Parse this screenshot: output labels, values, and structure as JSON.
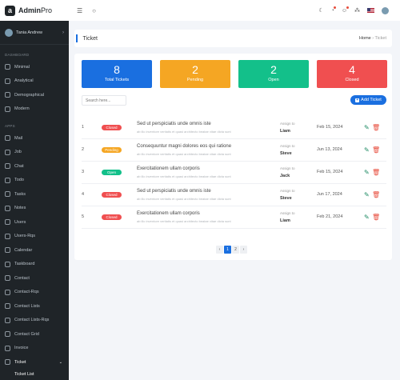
{
  "brand": {
    "name_bold": "Admin",
    "name_light": "Pro"
  },
  "user": {
    "name": "Tania Andrew"
  },
  "sidebar": {
    "dashboard_label": "DASHBOARD",
    "dashboard_items": [
      {
        "label": "Minimal"
      },
      {
        "label": "Analytical"
      },
      {
        "label": "Demographical"
      },
      {
        "label": "Modern"
      }
    ],
    "apps_label": "APPS",
    "apps_items": [
      {
        "label": "Mail"
      },
      {
        "label": "Job"
      },
      {
        "label": "Chat"
      },
      {
        "label": "Todo"
      },
      {
        "label": "Tasks"
      },
      {
        "label": "Notes"
      },
      {
        "label": "Users"
      },
      {
        "label": "Users-Rqs"
      },
      {
        "label": "Calendar"
      },
      {
        "label": "Taskboard"
      },
      {
        "label": "Contact"
      },
      {
        "label": "Contact-Rqs"
      },
      {
        "label": "Contact Lists"
      },
      {
        "label": "Contact Lists-Rqs"
      },
      {
        "label": "Contact Grid"
      },
      {
        "label": "Invoice"
      },
      {
        "label": "Ticket"
      }
    ],
    "ticket_sub": "Ticket List"
  },
  "header": {
    "title": "Ticket",
    "crumb_home": "Home",
    "crumb_sep": "›",
    "crumb_current": "Ticket"
  },
  "stats": [
    {
      "value": "8",
      "label": "Total Tickets",
      "color": "#1a6fe0"
    },
    {
      "value": "2",
      "label": "Pending",
      "color": "#f5a623"
    },
    {
      "value": "2",
      "label": "Open",
      "color": "#13c08a"
    },
    {
      "value": "4",
      "label": "Closed",
      "color": "#f04f50"
    }
  ],
  "search": {
    "placeholder": "Search here..."
  },
  "add_button": "Add Ticket",
  "assign_label": "Assign to",
  "tickets": [
    {
      "id": "1",
      "status": "Closed",
      "subject": "Sed ut perspiciatis unde omnis iste",
      "desc": "ab illo inventore veritatis et quasi architecto beatae vitae dicta sunt",
      "assignee": "Liam",
      "date": "Feb 15, 2024"
    },
    {
      "id": "2",
      "status": "Pending",
      "subject": "Consequuntur magni dolores eos qui ratione",
      "desc": "ab illo inventore veritatis et quasi architecto beatae vitae dicta sunt",
      "assignee": "Steve",
      "date": "Jun 13, 2024"
    },
    {
      "id": "3",
      "status": "Open",
      "subject": "Exercitationem ullam corporis",
      "desc": "ab illo inventore veritatis et quasi architecto beatae vitae dicta sunt",
      "assignee": "Jack",
      "date": "Feb 15, 2024"
    },
    {
      "id": "4",
      "status": "Closed",
      "subject": "Sed ut perspiciatis unde omnis iste",
      "desc": "ab illo inventore veritatis et quasi architecto beatae vitae dicta sunt",
      "assignee": "Steve",
      "date": "Jun 17, 2024"
    },
    {
      "id": "5",
      "status": "Closed",
      "subject": "Exercitationem ullam corporis",
      "desc": "ab illo inventore veritatis et quasi architecto beatae vitae dicta sunt",
      "assignee": "Liam",
      "date": "Feb 21, 2024"
    }
  ],
  "status_colors": {
    "Closed": "#f04f50",
    "Pending": "#f5a623",
    "Open": "#13c08a"
  },
  "pagination": {
    "prev": "‹",
    "pages": [
      "1",
      "2"
    ],
    "next": "›",
    "active": "1"
  }
}
